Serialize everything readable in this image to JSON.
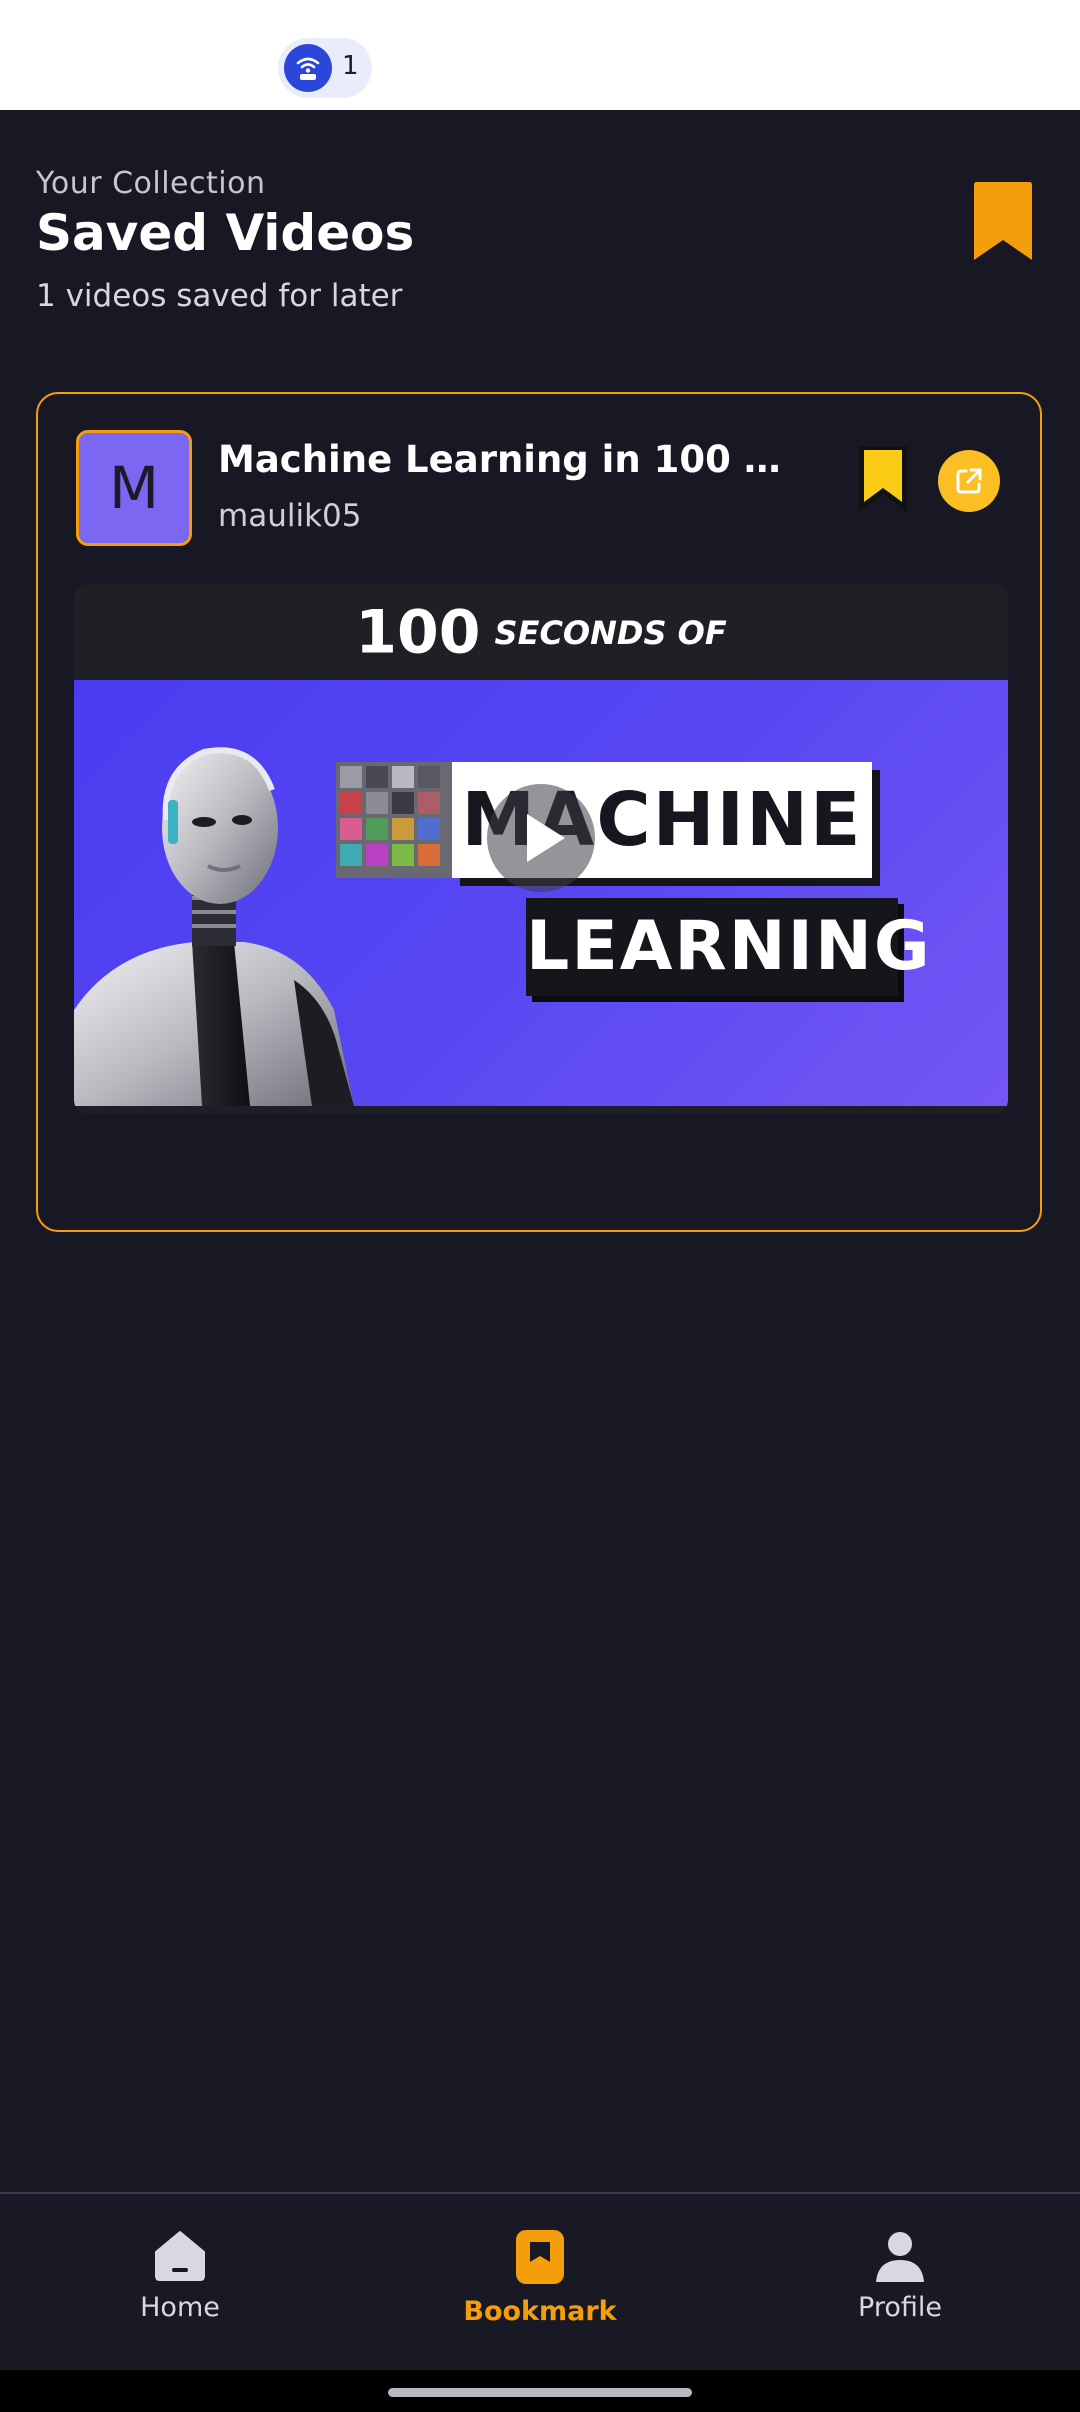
{
  "status_bar": {
    "hotspot_count": "1"
  },
  "header": {
    "eyebrow": "Your Collection",
    "title": "Saved Videos",
    "subtitle": "1 videos saved for later",
    "accent_color": "#f59e0b"
  },
  "videos": [
    {
      "avatar_letter": "M",
      "title": "Machine Learning in 100 seco...",
      "channel": "maulik05",
      "thumbnail": {
        "top_number": "100",
        "top_text": "SECONDS OF",
        "word_1": "MACHINE",
        "word_2": "LEARNING"
      }
    }
  ],
  "bottom_nav": {
    "items": [
      {
        "label": "Home",
        "icon": "home-icon",
        "active": false
      },
      {
        "label": "Bookmark",
        "icon": "bookmark-icon",
        "active": true
      },
      {
        "label": "Profile",
        "icon": "profile-icon",
        "active": false
      }
    ]
  },
  "colors": {
    "background": "#181824",
    "accent": "#f59e0b",
    "avatar": "#7b67f2",
    "share": "#fbbf24",
    "bookmark_saved": "#facc15"
  }
}
